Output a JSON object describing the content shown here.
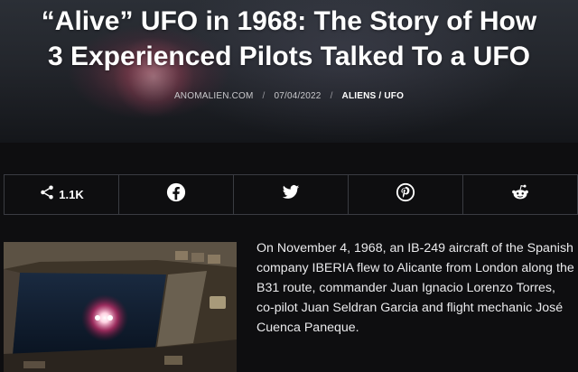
{
  "article": {
    "title_line1": "“Alive” UFO in 1968: The Story of How",
    "title_line2": "3 Experienced Pilots Talked To a UFO",
    "meta": {
      "author": "ANOMALIEN.COM",
      "date": "07/04/2022",
      "category": "ALIENS / UFO"
    },
    "paragraph": "On November 4, 1968, an IB-249 aircraft of the Spanish company IBERIA flew to Alicante from London along the B31 route, commander Juan Ignacio Lorenzo Torres, co-pilot Juan Seldran Garcia and flight mechanic José Cuenca Paneque."
  },
  "share_bar": {
    "count": "1.1K",
    "buttons": [
      {
        "icon": "share-icon"
      },
      {
        "icon": "facebook-icon"
      },
      {
        "icon": "twitter-icon"
      },
      {
        "icon": "pinterest-icon"
      },
      {
        "icon": "reddit-icon"
      }
    ]
  },
  "colors": {
    "page_background": "#0e0e10",
    "border": "#3a3c42",
    "text": "#ffffff"
  }
}
